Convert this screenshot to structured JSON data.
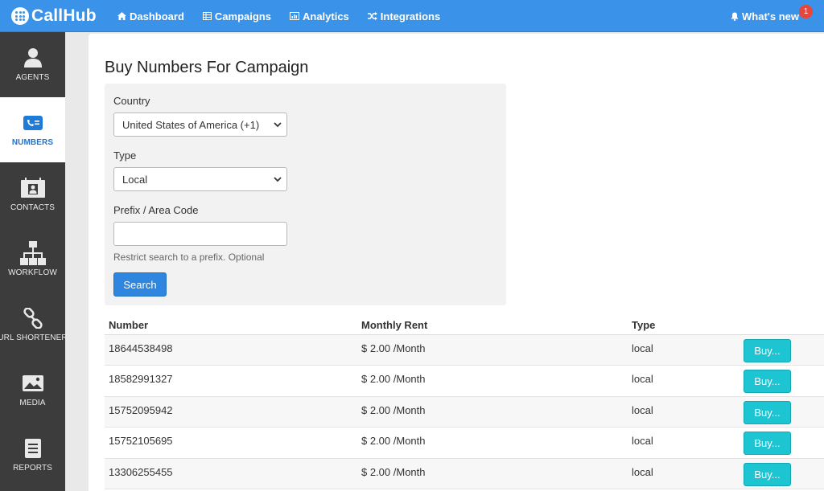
{
  "app": {
    "name": "CallHub"
  },
  "topnav": {
    "items": [
      {
        "label": "Dashboard",
        "icon": "home-icon"
      },
      {
        "label": "Campaigns",
        "icon": "table-icon"
      },
      {
        "label": "Analytics",
        "icon": "chart-icon"
      },
      {
        "label": "Integrations",
        "icon": "shuffle-icon"
      }
    ],
    "whats_new": {
      "label": "What's new",
      "icon": "bell-icon",
      "badge": "1"
    }
  },
  "sidebar": {
    "items": [
      {
        "label": "AGENTS",
        "icon": "user-icon",
        "active": false
      },
      {
        "label": "NUMBERS",
        "icon": "phone-card-icon",
        "active": true
      },
      {
        "label": "CONTACTS",
        "icon": "contact-card-icon",
        "active": false
      },
      {
        "label": "WORKFLOW",
        "icon": "sitemap-icon",
        "active": false
      },
      {
        "label": "URL SHORTENER",
        "icon": "link-icon",
        "active": false
      },
      {
        "label": "MEDIA",
        "icon": "image-icon",
        "active": false
      },
      {
        "label": "REPORTS",
        "icon": "document-icon",
        "active": false
      }
    ]
  },
  "page": {
    "title": "Buy Numbers For Campaign",
    "form": {
      "country_label": "Country",
      "country_value": "United States of America (+1)",
      "type_label": "Type",
      "type_value": "Local",
      "prefix_label": "Prefix / Area Code",
      "prefix_value": "",
      "prefix_help": "Restrict search to a prefix. Optional",
      "search_label": "Search"
    },
    "table": {
      "headers": {
        "number": "Number",
        "rent": "Monthly Rent",
        "type": "Type"
      },
      "buy_label": "Buy...",
      "rows": [
        {
          "number": "18644538498",
          "rent": "$ 2.00 /Month",
          "type": "local"
        },
        {
          "number": "18582991327",
          "rent": "$ 2.00 /Month",
          "type": "local"
        },
        {
          "number": "15752095942",
          "rent": "$ 2.00 /Month",
          "type": "local"
        },
        {
          "number": "15752105695",
          "rent": "$ 2.00 /Month",
          "type": "local"
        },
        {
          "number": "13306255455",
          "rent": "$ 2.00 /Month",
          "type": "local"
        }
      ]
    }
  },
  "colors": {
    "topbar": "#3a93e8",
    "sidebar": "#3c3c3c",
    "active_label": "#2672c8",
    "search_button": "#2e86de",
    "buy_button": "#1dc4d1",
    "badge": "#e8453c"
  }
}
